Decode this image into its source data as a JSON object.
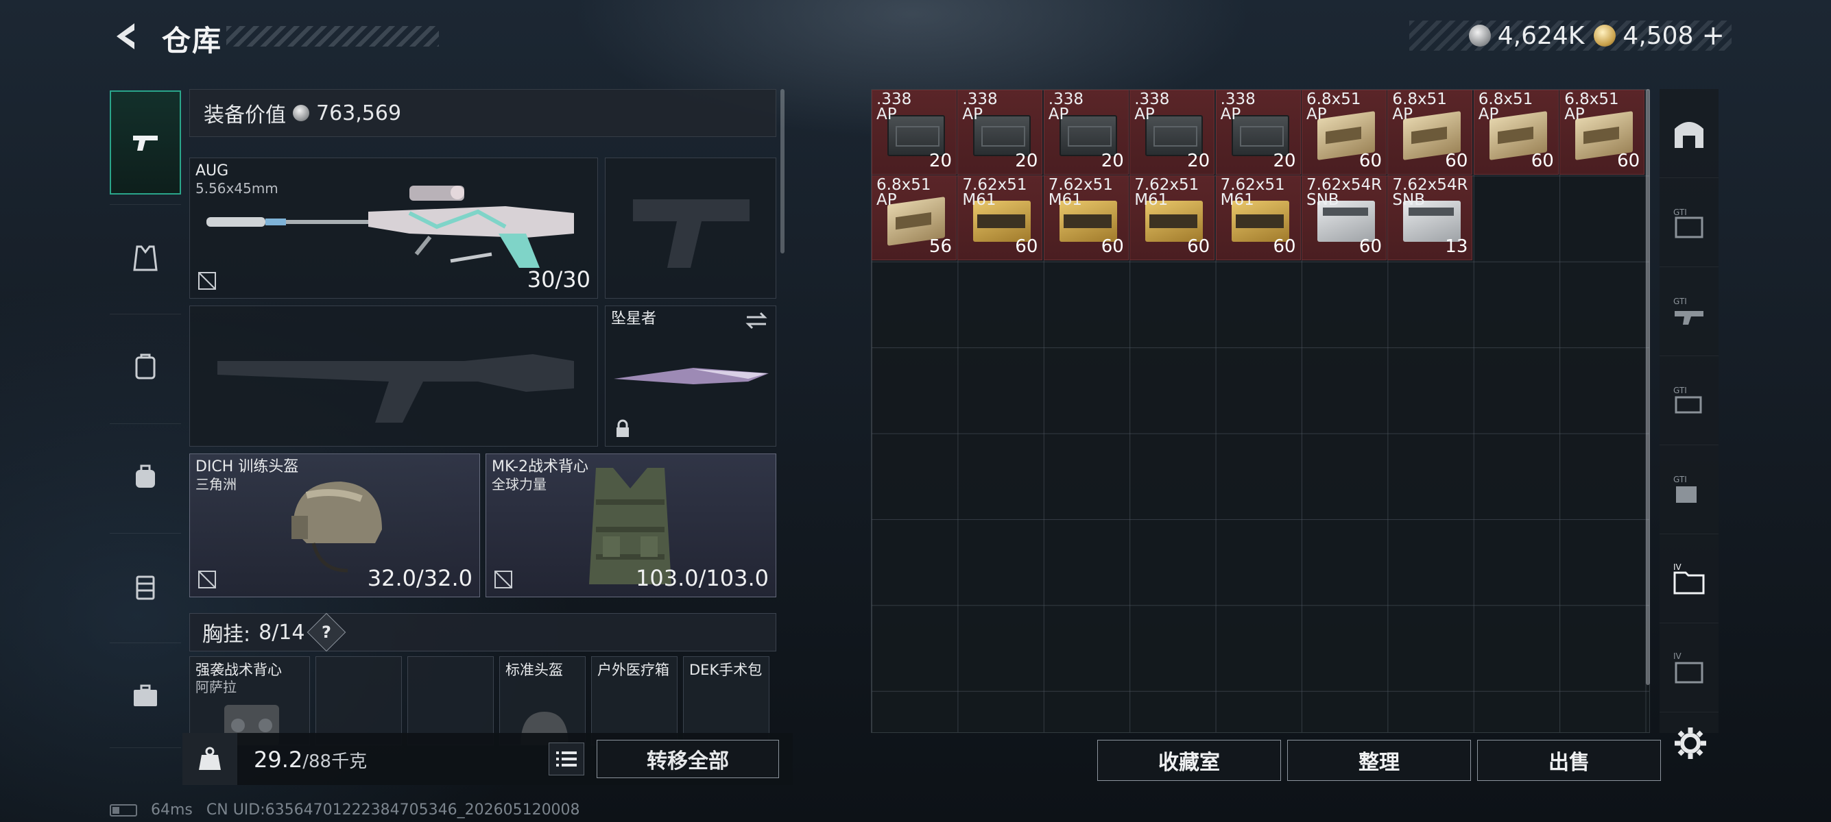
{
  "header": {
    "title": "仓库",
    "currencies": [
      {
        "icon": "silver-coin-icon",
        "value": "4,624K"
      },
      {
        "icon": "gold-coin-icon",
        "value": "4,508"
      }
    ],
    "add_label": "+"
  },
  "equipment": {
    "value_label": "装备价值",
    "value": "763,569",
    "primary_weapon": {
      "name": "AUG",
      "caliber": "5.56x45mm",
      "ammo": "30/30"
    },
    "melee": {
      "name": "坠星者"
    },
    "helmet": {
      "name": "DICH 训练头盔",
      "faction": "三角洲",
      "durability": "32.0/32.0"
    },
    "armor": {
      "name": "MK-2战术背心",
      "faction": "全球力量",
      "durability": "103.0/103.0"
    },
    "rig": {
      "label": "胸挂:",
      "value": "8/14",
      "help": "?"
    },
    "pockets": [
      {
        "label": "强袭战术背心",
        "sub": "阿萨拉"
      },
      {
        "label": "",
        "sub": ""
      },
      {
        "label": "",
        "sub": ""
      },
      {
        "label": "标准头盔",
        "sub": ""
      },
      {
        "label": "户外医疗箱",
        "sub": ""
      },
      {
        "label": "DEK手术包",
        "sub": ""
      }
    ]
  },
  "weight": {
    "current": "29.2",
    "max": "/88千克"
  },
  "buttons": {
    "transfer_all": "转移全部",
    "collection": "收藏室",
    "organize": "整理",
    "sell": "出售"
  },
  "stash_items": [
    {
      "caliber": ".338",
      "type": "AP",
      "count": "20",
      "style": "ammo-dark"
    },
    {
      "caliber": ".338",
      "type": "AP",
      "count": "20",
      "style": "ammo-dark"
    },
    {
      "caliber": ".338",
      "type": "AP",
      "count": "20",
      "style": "ammo-dark"
    },
    {
      "caliber": ".338",
      "type": "AP",
      "count": "20",
      "style": "ammo-dark"
    },
    {
      "caliber": ".338",
      "type": "AP",
      "count": "20",
      "style": "ammo-dark"
    },
    {
      "caliber": "6.8x51",
      "type": "AP",
      "count": "60",
      "style": "ammo-tan"
    },
    {
      "caliber": "6.8x51",
      "type": "AP",
      "count": "60",
      "style": "ammo-tan"
    },
    {
      "caliber": "6.8x51",
      "type": "AP",
      "count": "60",
      "style": "ammo-tan"
    },
    {
      "caliber": "6.8x51",
      "type": "AP",
      "count": "60",
      "style": "ammo-tan"
    },
    {
      "caliber": "6.8x51",
      "type": "AP",
      "count": "56",
      "style": "ammo-tan"
    },
    {
      "caliber": "7.62x51",
      "type": "M61",
      "count": "60",
      "style": "ammo-yellow"
    },
    {
      "caliber": "7.62x51",
      "type": "M61",
      "count": "60",
      "style": "ammo-yellow"
    },
    {
      "caliber": "7.62x51",
      "type": "M61",
      "count": "60",
      "style": "ammo-yellow"
    },
    {
      "caliber": "7.62x51",
      "type": "M61",
      "count": "60",
      "style": "ammo-yellow"
    },
    {
      "caliber": "7.62x54R",
      "type": "SNB",
      "count": "60",
      "style": "ammo-white"
    },
    {
      "caliber": "7.62x54R",
      "type": "SNB",
      "count": "13",
      "style": "ammo-white"
    }
  ],
  "status": {
    "ping": "64ms",
    "uid": "CN UID:635647012223847053​46_202605120008"
  },
  "colors": {
    "item_bg": "#5a2528",
    "accent": "#2aa58a"
  }
}
